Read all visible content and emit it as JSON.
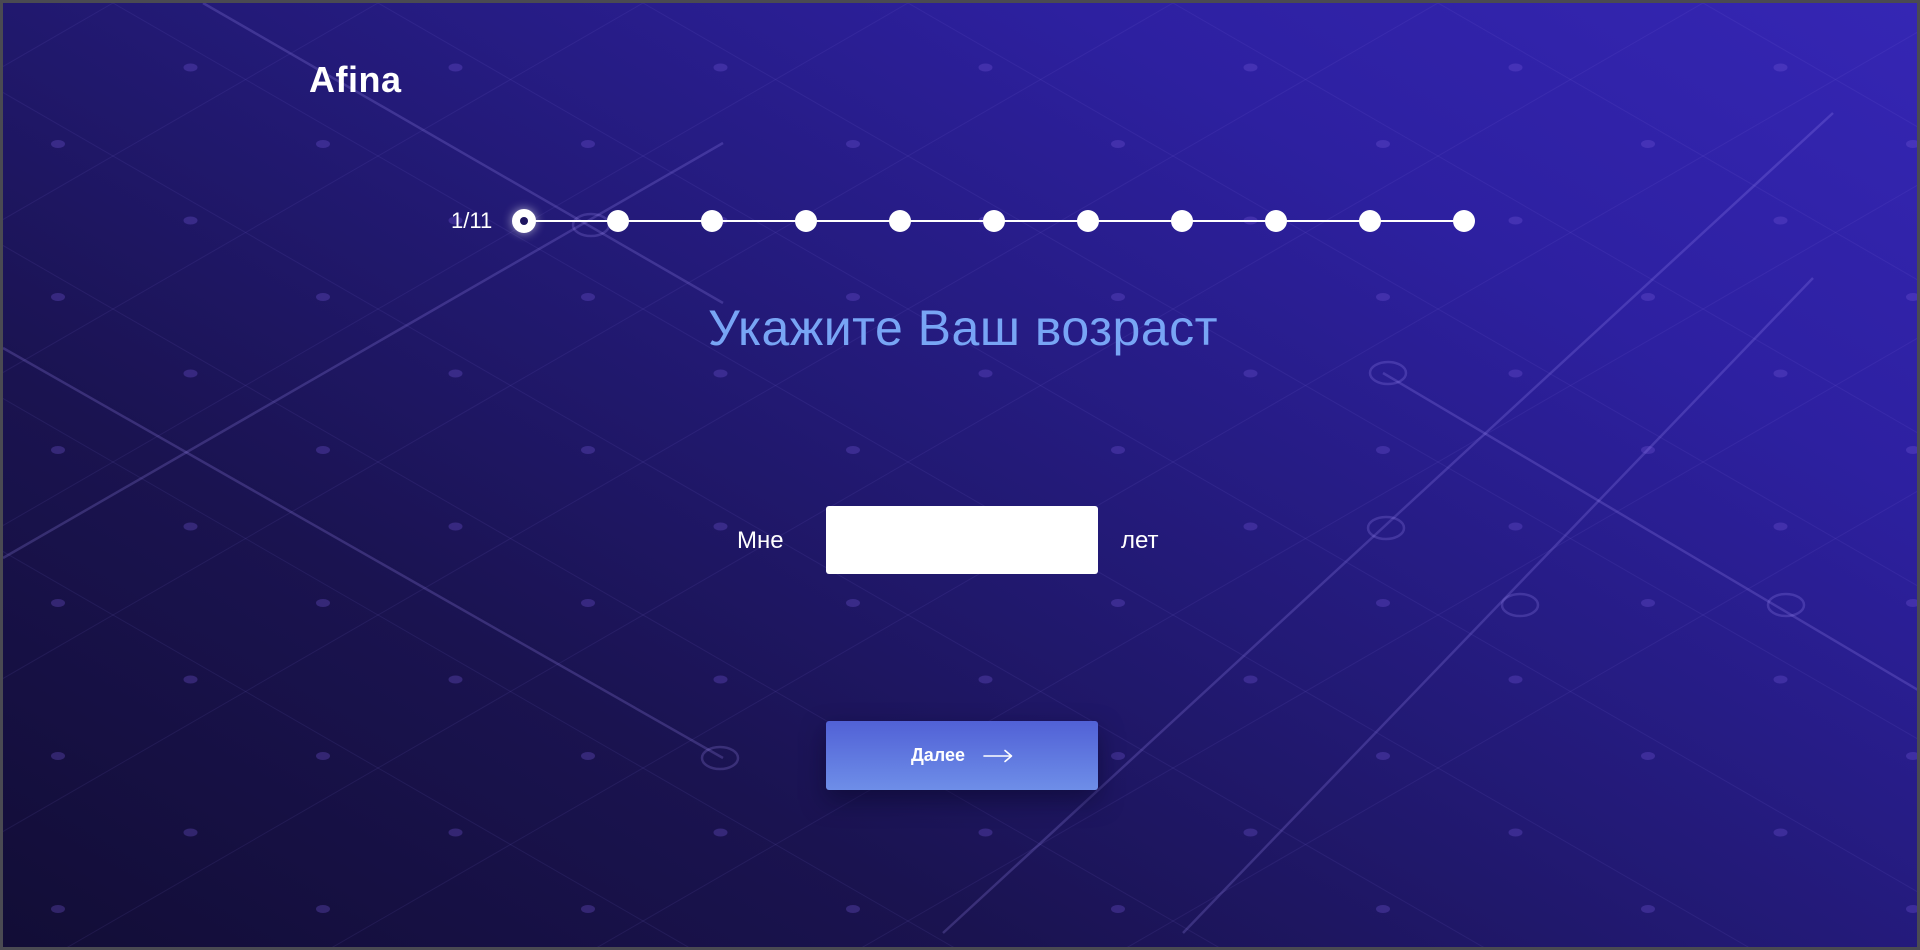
{
  "app": {
    "logo": "Afina"
  },
  "progress": {
    "counter": "1/11",
    "current_step": 1,
    "total_steps": 11
  },
  "question": {
    "title": "Укажите Ваш возраст"
  },
  "age_form": {
    "prefix_label": "Мне",
    "input_value": "",
    "input_placeholder": "",
    "suffix_label": "лет"
  },
  "actions": {
    "next_label": "Далее",
    "next_icon": "arrow-right-icon"
  },
  "colors": {
    "background_dark": "#120d36",
    "background_light": "#3526b4",
    "title": "#78a5f5",
    "button_top": "#5161d6",
    "button_bottom": "#6e8ee8"
  }
}
